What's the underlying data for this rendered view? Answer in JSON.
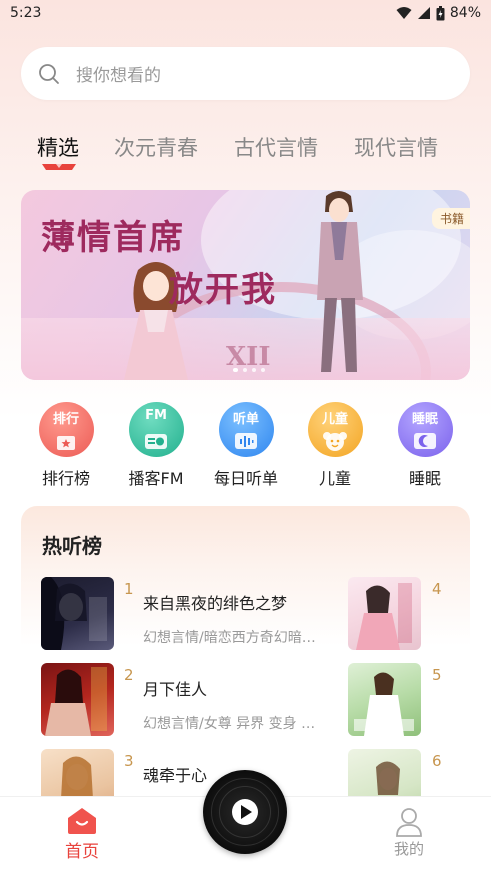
{
  "status_bar": {
    "time": "5:23",
    "battery": "84%"
  },
  "search": {
    "placeholder": "搜你想看的"
  },
  "tabs": [
    {
      "label": "精选",
      "active": true
    },
    {
      "label": "次元青春",
      "active": false
    },
    {
      "label": "古代言情",
      "active": false
    },
    {
      "label": "现代言情",
      "active": false
    }
  ],
  "banner": {
    "title_line1": "薄情首席",
    "title_line2": "放开我",
    "roman": "XII",
    "tag": "书籍",
    "page_count": 4,
    "active_index": 0
  },
  "quick_entries": [
    {
      "badge": "排行",
      "label": "排行榜",
      "icon": "ranking-icon",
      "color": "#f0736c"
    },
    {
      "badge": "FM",
      "label": "播客FM",
      "icon": "radio-icon",
      "color": "#34c0a0"
    },
    {
      "badge": "听单",
      "label": "每日听单",
      "icon": "audio-wave-icon",
      "color": "#3f9af3"
    },
    {
      "badge": "儿童",
      "label": "儿童",
      "icon": "kids-icon",
      "color": "#f7b43a"
    },
    {
      "badge": "睡眠",
      "label": "睡眠",
      "icon": "moon-icon",
      "color": "#8f7af0"
    }
  ],
  "hot_list": {
    "title": "热听榜",
    "items": [
      {
        "rank": "1",
        "title": "来自黑夜的绯色之梦",
        "tags": "幻想言情/暗恋西方奇幻暗…",
        "right_rank": "4"
      },
      {
        "rank": "2",
        "title": "月下佳人",
        "tags": "幻想言情/女尊 异界 变身 …",
        "right_rank": "5"
      },
      {
        "rank": "3",
        "title": "魂牵于心",
        "tags": "",
        "right_rank": "6"
      }
    ]
  },
  "bottom_nav": {
    "home_label": "首页",
    "mine_label": "我的"
  }
}
